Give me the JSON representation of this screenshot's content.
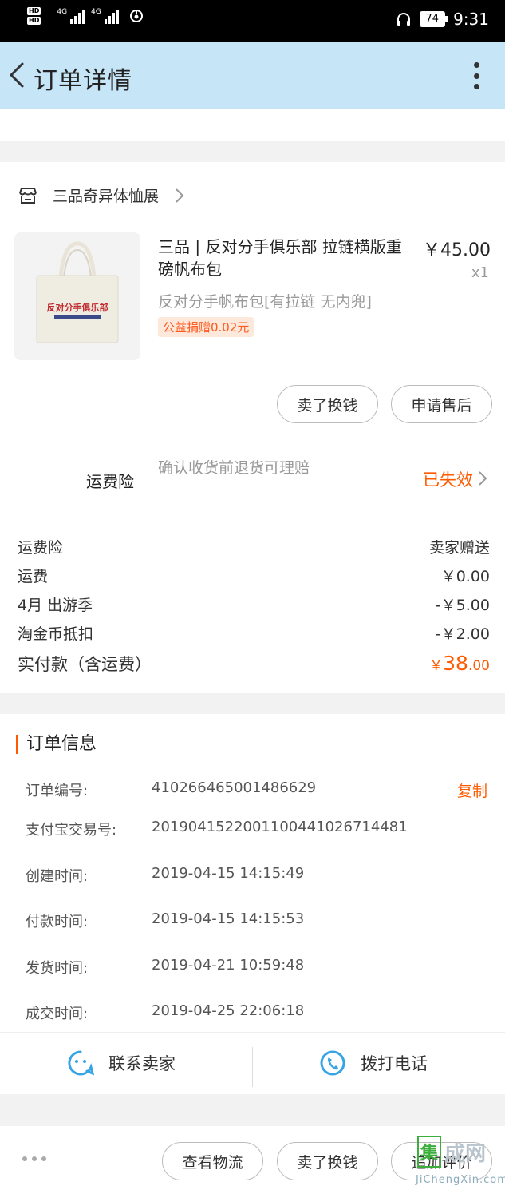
{
  "status_bar": {
    "hd1": "HD",
    "hd2": "HD",
    "net1": "4G",
    "net2": "4G",
    "battery": "74",
    "time": "9:31"
  },
  "header": {
    "title": "订单详情"
  },
  "shop": {
    "name": "三品奇异体恤展"
  },
  "product": {
    "title": "三品 | 反对分手俱乐部 拉链横版重磅帆布包",
    "price": "￥45.00",
    "qty": "x1",
    "spec": "反对分手帆布包[有拉链 无内兜]",
    "charity": "公益捐赠0.02元",
    "image_text": "反对分手俱乐部"
  },
  "item_buttons": {
    "sell": "卖了换钱",
    "after_sale": "申请售后"
  },
  "insurance": {
    "label": "运费险",
    "desc": "确认收货前退货可理赔",
    "status": "已失效"
  },
  "fees": [
    {
      "label": "运费险",
      "value": "卖家赠送"
    },
    {
      "label": "运费",
      "value": "￥0.00"
    },
    {
      "label": "4月 出游季",
      "value": "-￥5.00"
    },
    {
      "label": "淘金币抵扣",
      "value": "-￥2.00"
    }
  ],
  "paid": {
    "label": "实付款（含运费）",
    "currency": "￥",
    "integer": "38",
    "decimal": ".00"
  },
  "order_info": {
    "title": "订单信息",
    "copy": "复制",
    "rows": [
      {
        "label": "订单编号:",
        "value": "410266465001486629"
      },
      {
        "label": "支付宝交易号:",
        "value": "2019041522001100441026714481"
      },
      {
        "label": "创建时间:",
        "value": "2019-04-15 14:15:49"
      },
      {
        "label": "付款时间:",
        "value": "2019-04-15 14:15:53"
      },
      {
        "label": "发货时间:",
        "value": "2019-04-21 10:59:48"
      },
      {
        "label": "成交时间:",
        "value": "2019-04-25 22:06:18"
      }
    ]
  },
  "actions": {
    "contact": "联系卖家",
    "call": "拨打电话"
  },
  "bottom_bar": {
    "logistics": "查看物流",
    "sell": "卖了换钱",
    "review": "追加评价"
  },
  "watermark": {
    "box": "集",
    "text": "成网",
    "url": "JiChengXin.com"
  },
  "colors": {
    "accent": "#ff5a00",
    "header_bg": "#c6e5f7",
    "action_icon": "#35a5e6"
  }
}
